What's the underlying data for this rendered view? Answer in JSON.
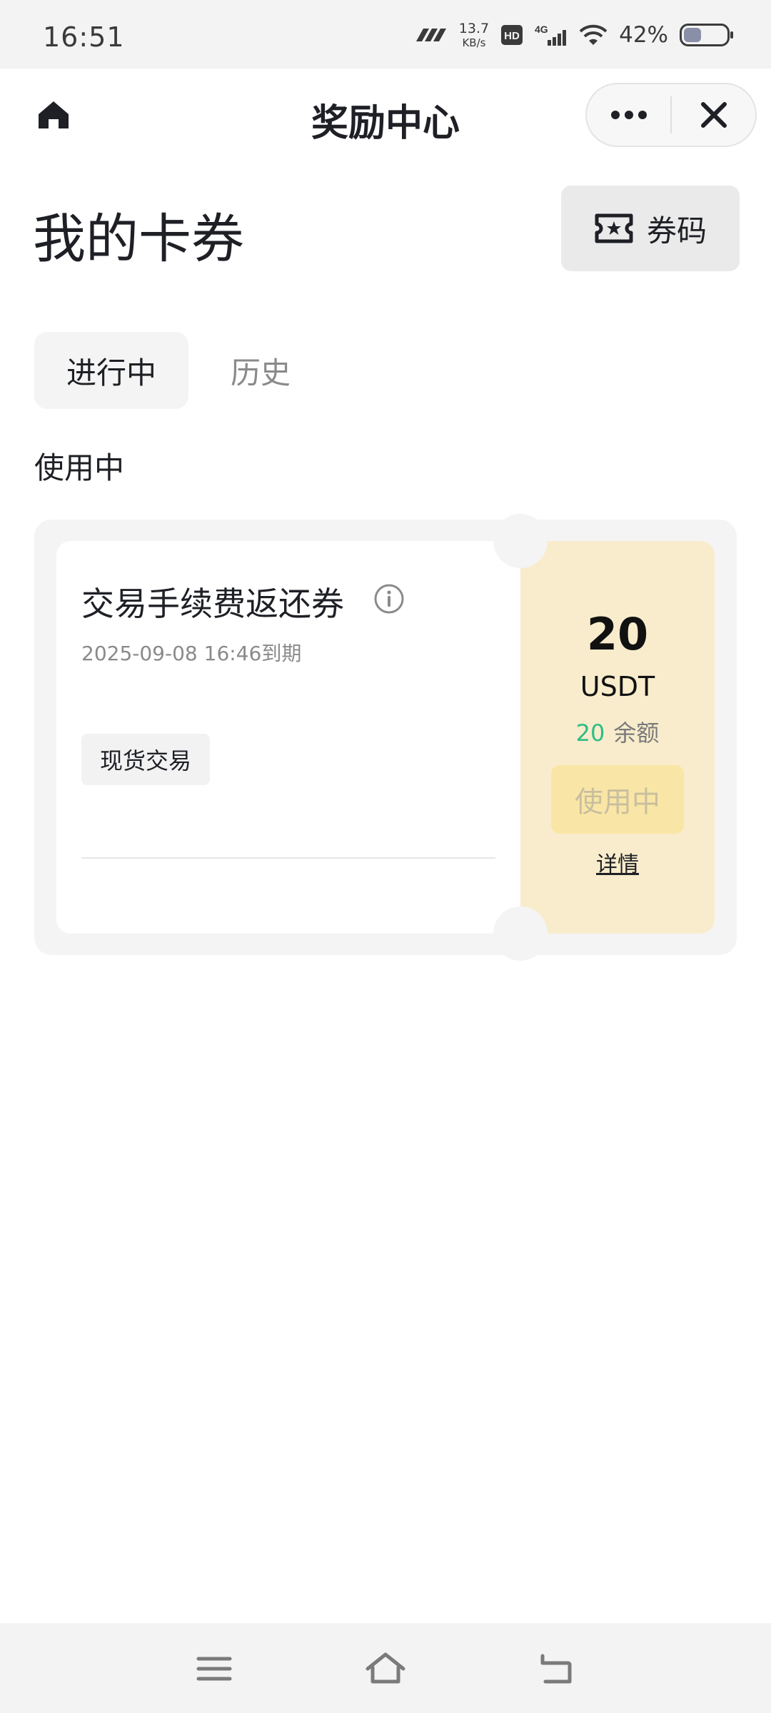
{
  "status_bar": {
    "time": "16:51",
    "net_speed_value": "13.7",
    "net_speed_unit": "KB/s",
    "hd_label": "HD",
    "network_label": "4G",
    "battery_percent": "42%",
    "battery_level": 0.42
  },
  "nav": {
    "title": "奖励中心",
    "icons": {
      "home": "home-icon",
      "more": "more-icon",
      "close": "close-icon"
    }
  },
  "header": {
    "title": "我的卡券",
    "code_button_label": "券码",
    "code_button_icon": "ticket-icon"
  },
  "tabs": [
    {
      "label": "进行中",
      "active": true
    },
    {
      "label": "历史",
      "active": false
    }
  ],
  "section_label": "使用中",
  "coupon": {
    "title": "交易手续费返还券",
    "expiry": "2025-09-08 16:46到期",
    "tag": "现货交易",
    "amount": "20",
    "currency": "USDT",
    "balance_value": "20",
    "balance_label": "余额",
    "status_button": "使用中",
    "detail_link": "详情"
  },
  "colors": {
    "accent_yellow": "#f9e6a6",
    "panel_yellow": "#f8eccc",
    "balance_green": "#2ebd85",
    "text_primary": "#1e2026",
    "text_secondary": "#8a8a8a"
  },
  "system_nav": {
    "icons": {
      "menu": "menu-icon",
      "home": "home-outline-icon",
      "back": "back-icon"
    }
  }
}
